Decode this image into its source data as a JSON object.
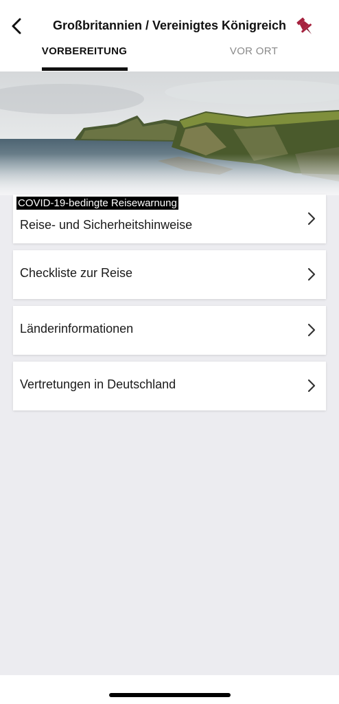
{
  "header": {
    "title": "Großbritannien / Vereinigtes Königreich",
    "back_icon": "chevron-left-icon",
    "pin_icon": "pushpin-icon",
    "pin_color": "#a6233f"
  },
  "tabs": [
    {
      "label": "VORBEREITUNG",
      "active": true
    },
    {
      "label": "VOR ORT",
      "active": false
    }
  ],
  "warning": {
    "text": "COVID-19-bedingte Reisewarnung"
  },
  "menu": {
    "items": [
      {
        "label": "Reise- und Sicherheitshinweise"
      },
      {
        "label": "Checkliste zur Reise"
      },
      {
        "label": "Länderinformationen"
      },
      {
        "label": "Vertretungen in Deutschland"
      }
    ],
    "chevron_icon": "chevron-right-icon"
  },
  "colors": {
    "accent": "#a6233f",
    "background": "#ececf0",
    "active_tab": "#111111",
    "inactive_tab": "#8a8a8a"
  }
}
